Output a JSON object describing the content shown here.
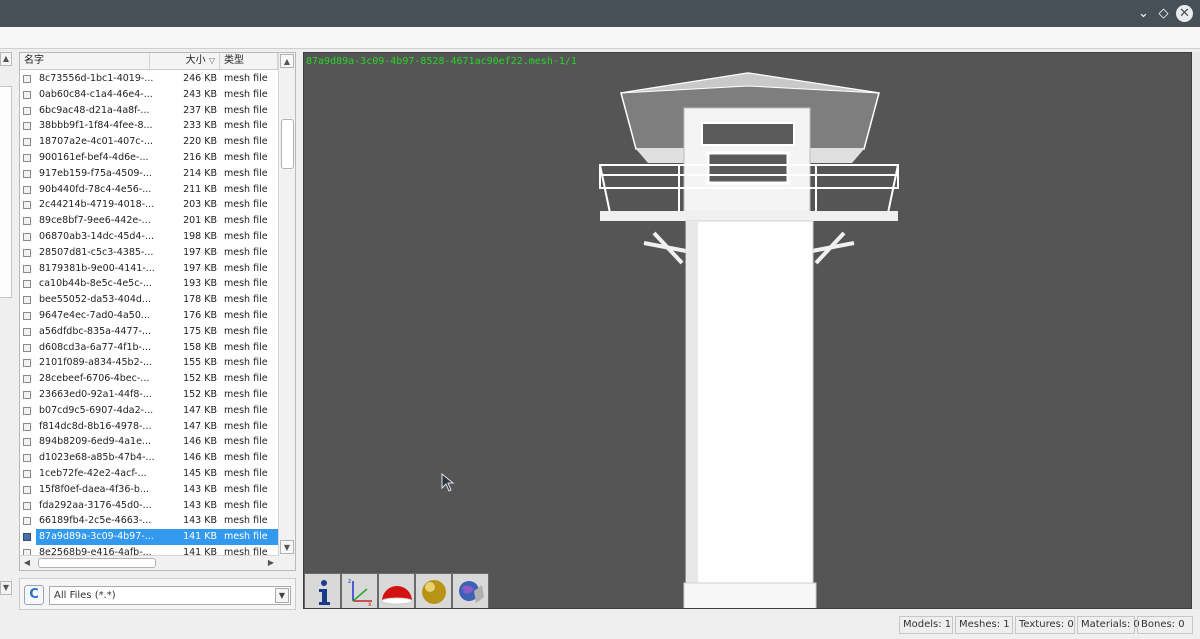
{
  "titlebar": {
    "minimize_glyph": "⌄",
    "restore_glyph": "◇",
    "close_glyph": "✕"
  },
  "file_list": {
    "columns": {
      "name": "名字",
      "size": "大小",
      "type": "类型"
    },
    "rows": [
      {
        "name": "8c73556d-1bc1-4019-...",
        "size": "246 KB",
        "type": "mesh file"
      },
      {
        "name": "0ab60c84-c1a4-46e4-...",
        "size": "243 KB",
        "type": "mesh file"
      },
      {
        "name": "6bc9ac48-d21a-4a8f-...",
        "size": "237 KB",
        "type": "mesh file"
      },
      {
        "name": "38bbb9f1-1f84-4fee-8...",
        "size": "233 KB",
        "type": "mesh file"
      },
      {
        "name": "18707a2e-4c01-407c-...",
        "size": "220 KB",
        "type": "mesh file"
      },
      {
        "name": "900161ef-bef4-4d6e-...",
        "size": "216 KB",
        "type": "mesh file"
      },
      {
        "name": "917eb159-f75a-4509-...",
        "size": "214 KB",
        "type": "mesh file"
      },
      {
        "name": "90b440fd-78c4-4e56-...",
        "size": "211 KB",
        "type": "mesh file"
      },
      {
        "name": "2c44214b-4719-4018-...",
        "size": "203 KB",
        "type": "mesh file"
      },
      {
        "name": "89ce8bf7-9ee6-442e-...",
        "size": "201 KB",
        "type": "mesh file"
      },
      {
        "name": "06870ab3-14dc-45d4-...",
        "size": "198 KB",
        "type": "mesh file"
      },
      {
        "name": "28507d81-c5c3-4385-...",
        "size": "197 KB",
        "type": "mesh file"
      },
      {
        "name": "8179381b-9e00-4141-...",
        "size": "197 KB",
        "type": "mesh file"
      },
      {
        "name": "ca10b44b-8e5c-4e5c-...",
        "size": "193 KB",
        "type": "mesh file"
      },
      {
        "name": "bee55052-da53-404d...",
        "size": "178 KB",
        "type": "mesh file"
      },
      {
        "name": "9647e4ec-7ad0-4a50...",
        "size": "176 KB",
        "type": "mesh file"
      },
      {
        "name": "a56dfdbc-835a-4477-...",
        "size": "175 KB",
        "type": "mesh file"
      },
      {
        "name": "d608cd3a-6a77-4f1b-...",
        "size": "158 KB",
        "type": "mesh file"
      },
      {
        "name": "2101f089-a834-45b2-...",
        "size": "155 KB",
        "type": "mesh file"
      },
      {
        "name": "28cebeef-6706-4bec-...",
        "size": "152 KB",
        "type": "mesh file"
      },
      {
        "name": "23663ed0-92a1-44f8-...",
        "size": "152 KB",
        "type": "mesh file"
      },
      {
        "name": "b07cd9c5-6907-4da2-...",
        "size": "147 KB",
        "type": "mesh file"
      },
      {
        "name": "f814dc8d-8b16-4978-...",
        "size": "147 KB",
        "type": "mesh file"
      },
      {
        "name": "894b8209-6ed9-4a1e...",
        "size": "146 KB",
        "type": "mesh file"
      },
      {
        "name": "d1023e68-a85b-47b4-...",
        "size": "146 KB",
        "type": "mesh file"
      },
      {
        "name": "1ceb72fe-42e2-4acf-...",
        "size": "145 KB",
        "type": "mesh file"
      },
      {
        "name": "15f8f0ef-daea-4f36-b...",
        "size": "143 KB",
        "type": "mesh file"
      },
      {
        "name": "fda292aa-3176-45d0-...",
        "size": "143 KB",
        "type": "mesh file"
      },
      {
        "name": "66189fb4-2c5e-4663-...",
        "size": "143 KB",
        "type": "mesh file"
      },
      {
        "name": "87a9d89a-3c09-4b97-...",
        "size": "141 KB",
        "type": "mesh file",
        "selected": true
      },
      {
        "name": "8e2568b9-e416-4afb-...",
        "size": "141 KB",
        "type": "mesh file"
      }
    ]
  },
  "filter": {
    "refresh_glyph": "C",
    "value": "All Files (*.*)"
  },
  "viewport": {
    "mesh_label": "87a9d89a-3c09-4b97-8528-4671ac90ef22.mesh-1/1",
    "background": "#555555",
    "tools": [
      {
        "name": "info-icon"
      },
      {
        "name": "axes-icon"
      },
      {
        "name": "hemisphere-icon"
      },
      {
        "name": "gold-sphere-icon"
      },
      {
        "name": "globe-hand-icon"
      }
    ]
  },
  "status": {
    "models": "Models: 1",
    "meshes": "Meshes: 1",
    "textures": "Textures: 0",
    "materials": "Materials: 0",
    "bones": "Bones: 0"
  },
  "colors": {
    "titlebar": "#475057",
    "selection": "#3399ee",
    "label_green": "#28d428"
  }
}
